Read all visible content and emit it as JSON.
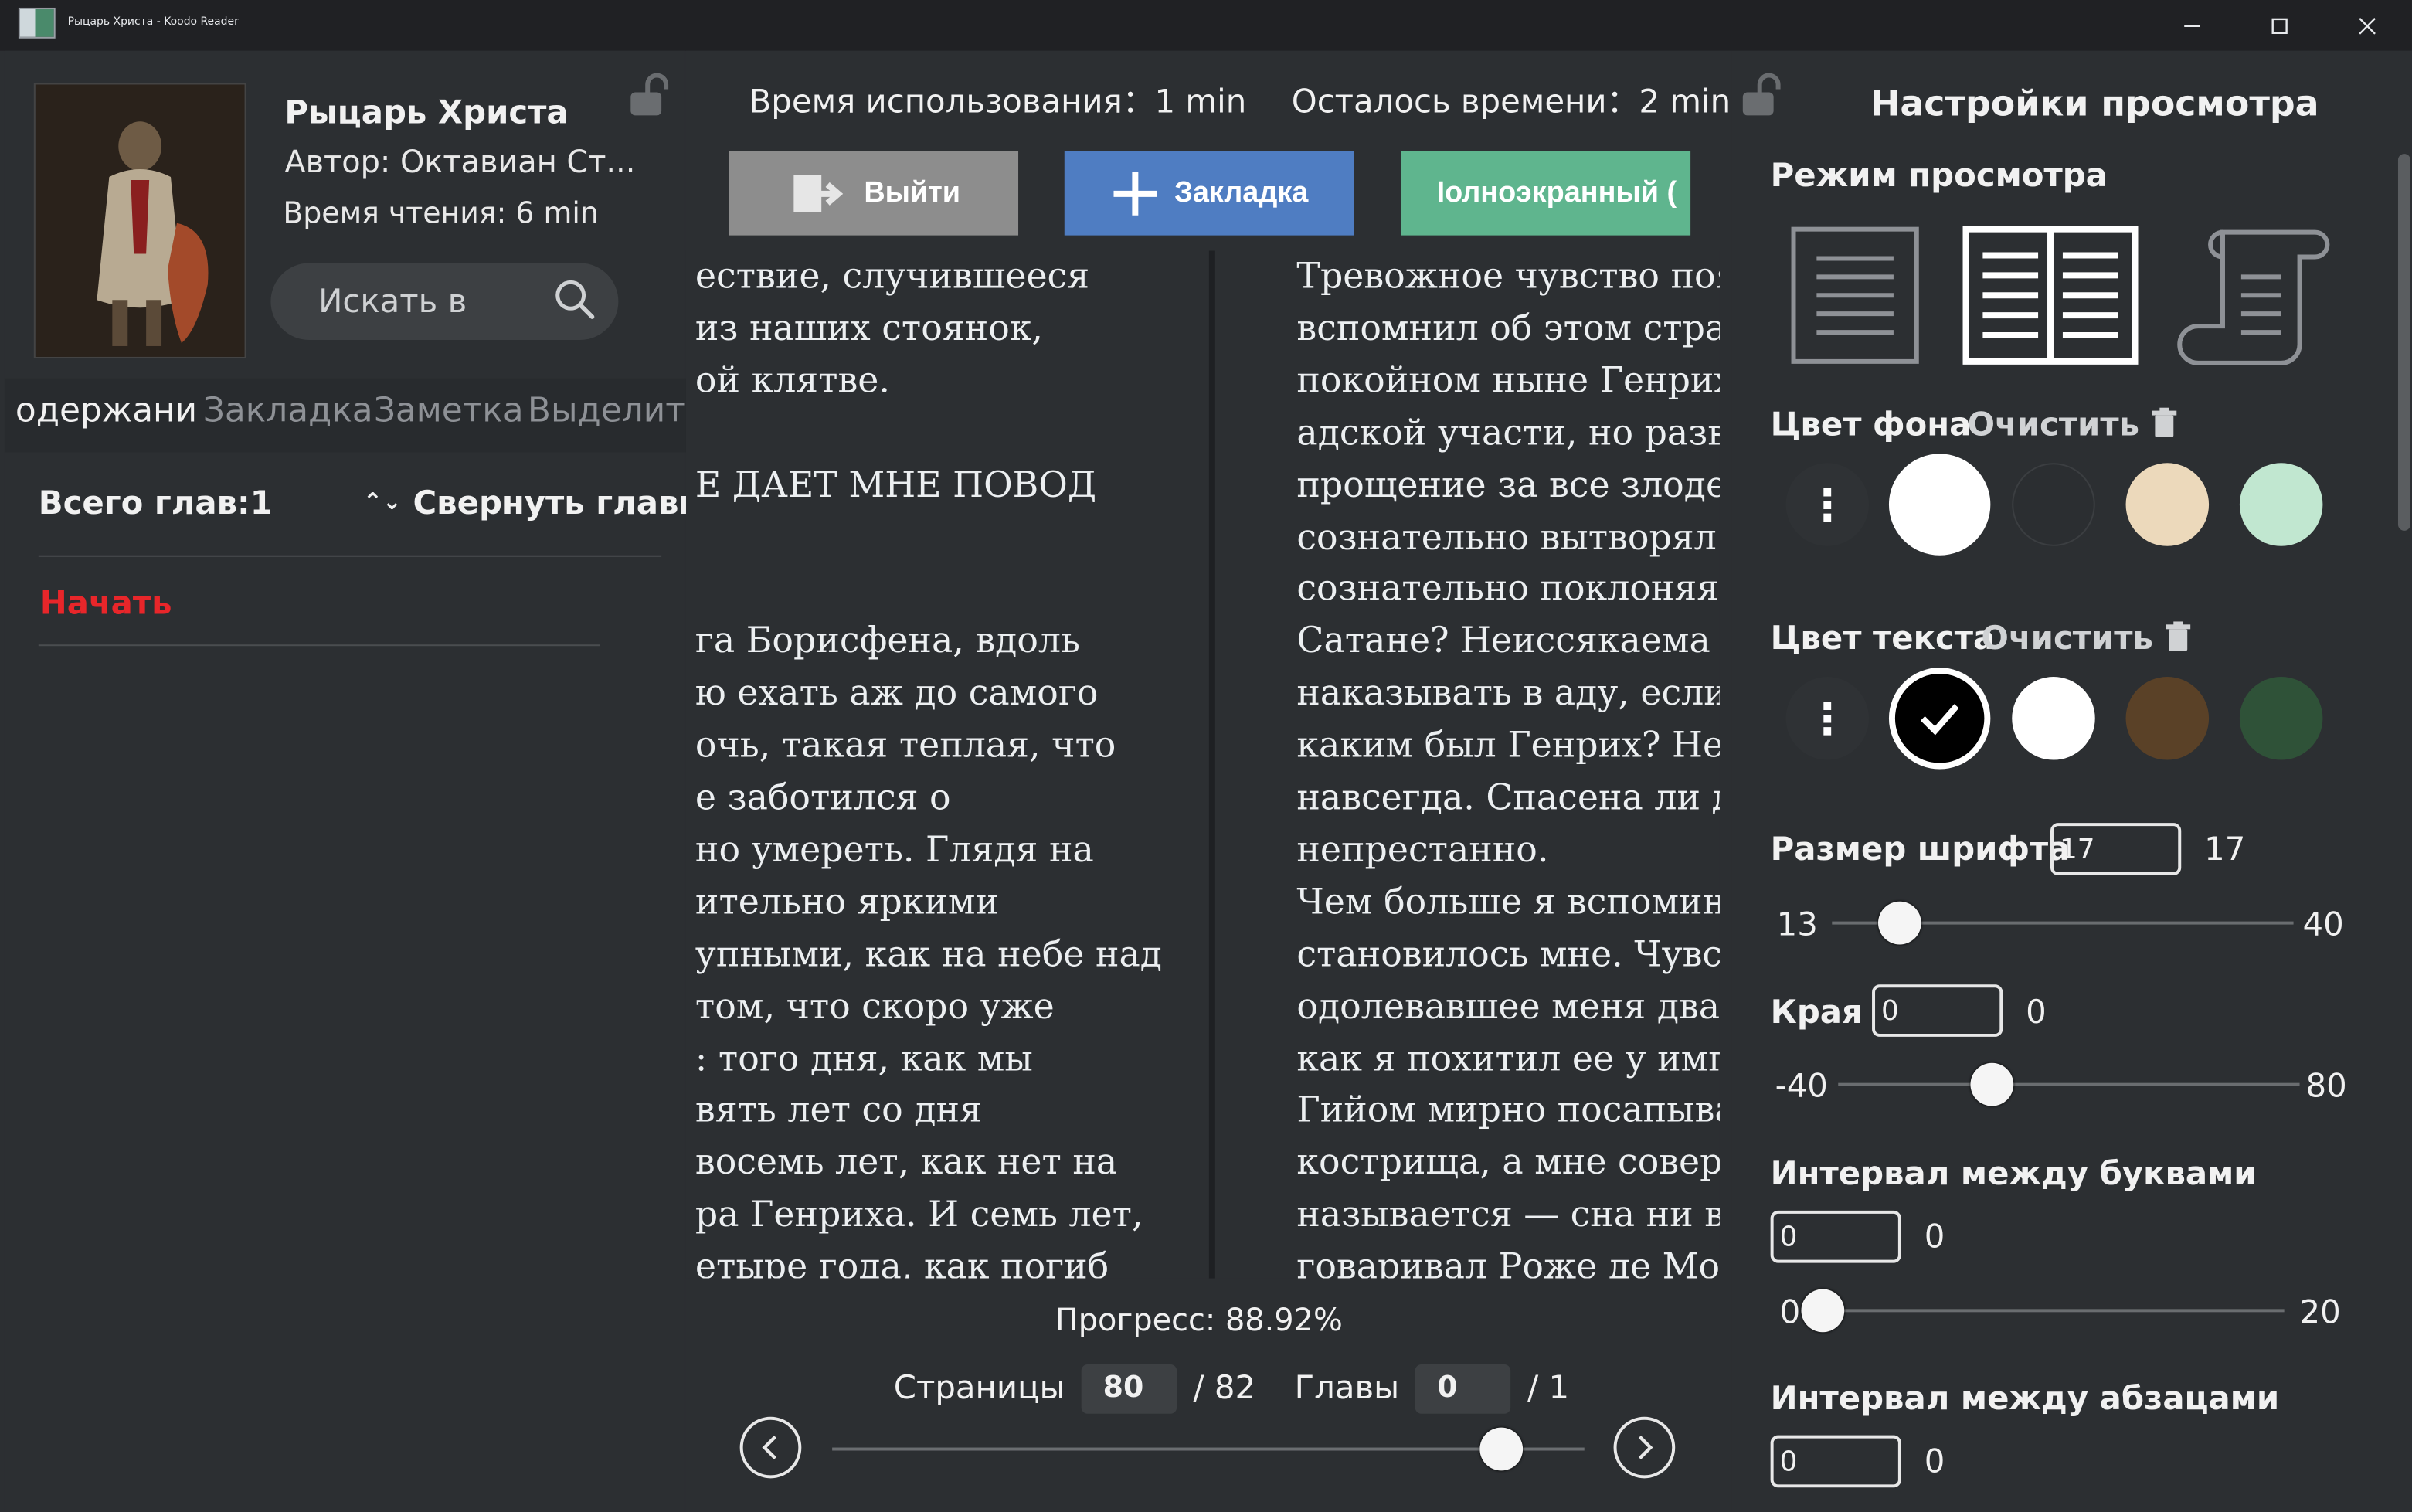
{
  "window": {
    "title": "Рыцарь Христа - Koodo Reader",
    "controls": {
      "minimize": "—",
      "maximize": "☐",
      "close": "✕"
    }
  },
  "book": {
    "title": "Рыцарь Христа",
    "author": "Автор: Октавиан Ст...",
    "reading_time": "Время чтения: 6  min"
  },
  "search": {
    "label": "Искать в"
  },
  "tabs": [
    "одержани",
    "Закладка",
    "Заметка",
    "Выделить"
  ],
  "toc": {
    "total": "Всего глав:1",
    "collapse": "Свернуть главы",
    "collapse_icon": "⌃⌄",
    "items": [
      "Начать"
    ]
  },
  "reader": {
    "time_used": "Время использования：1 min",
    "time_left": "Осталось времени：2 min",
    "buttons": {
      "exit": "Выйти",
      "bookmark": "Закладка",
      "fullscreen": "Іолноэкранный ("
    },
    "left_page": [
      "ествие, случившееся",
      " из наших стоянок,",
      "ой клятве.",
      "",
      "Е ДАЕТ МНЕ ПОВОД",
      "",
      "",
      "га Борисфена, вдоль",
      "ю ехать аж до самого",
      "очь, такая теплая, что",
      "е заботился о",
      "но умереть. Глядя на",
      "ительно яркими",
      "упными, как на небе над",
      "том, что скоро уже",
      ": того дня, как мы",
      "вять лет со дня",
      "восемь лет, как нет на",
      "ра Генриха. И семь лет,",
      "етыре года, как погиб"
    ],
    "right_page": [
      "Тревожное чувство появ",
      "вспомнил об этом страш",
      "покойном ныне Генрихе",
      "адской участи, но разве",
      "прощение за все злодей",
      "сознательно вытворял в",
      "сознательно поклоняясь",
      "Сатане? Неиссякаема ми",
      "наказывать в аду, если н",
      "каким был Генрих? Нет,",
      "навсегда. Спасена ли ду",
      "непрестанно.",
      "Чем больше я вспомина",
      "становилось мне. Чувст",
      "одолевавшее меня двадц",
      "как я похитил ее у импе",
      "Гийом мирно посапыва",
      "кострища, а мне соверш",
      "называется — сна ни в с",
      "говаривал Роже де Монл"
    ],
    "progress": "Прогресс: 88.92%",
    "pages_label": "Страницы",
    "page_current": "80",
    "page_total": "/ 82",
    "chapters_label": "Главы",
    "chapter_current": "0",
    "chapter_total": "/ 1",
    "slider_progress": 0.8892
  },
  "settings": {
    "title": "Настройки просмотра",
    "view_mode": "Режим просмотра",
    "view_modes": [
      "single-page",
      "double-page",
      "scroll"
    ],
    "selected_view_mode": "double-page",
    "bg_color": "Цвет фона",
    "text_color": "Цвет текста",
    "clear": "Очистить",
    "bg_swatches": [
      "#ffffff",
      "#2b2e31",
      "#ecd9bb",
      "#c1e7d0"
    ],
    "text_swatches": [
      "#000000",
      "#ffffff",
      "#5a4127",
      "#2f5238"
    ],
    "font_size": {
      "label": "Размер шрифта",
      "input": "17",
      "value": "17",
      "min": "13",
      "max": "40",
      "current": 17
    },
    "margins": {
      "label": "Края",
      "input": "0",
      "value": "0",
      "min": "-40",
      "max": "80",
      "current": 0
    },
    "letter_spacing": {
      "label": "Интервал между буквами",
      "input": "0",
      "value": "0",
      "min": "0",
      "max": "20",
      "current": 0
    },
    "paragraph_spacing": {
      "label": "Интервал между абзацами",
      "input": "0",
      "value": "0"
    }
  }
}
